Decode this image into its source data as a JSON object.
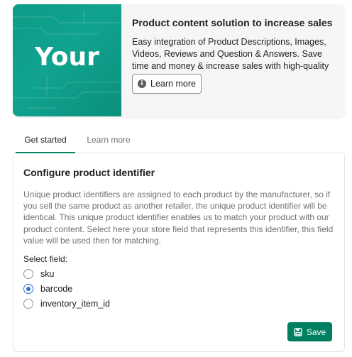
{
  "banner": {
    "logo_text": "Your",
    "title": "Product content solution to increase sales",
    "description": "Easy integration of Product Descriptions, Images, Videos, Reviews and Question & Answers. Save time and money & increase sales with high-quality content.",
    "learn_more_label": "Learn more",
    "info_icon": "info-icon",
    "brand_color": "#0c9b86"
  },
  "tabs": [
    {
      "label": "Get started",
      "active": true
    },
    {
      "label": "Learn more",
      "active": false
    }
  ],
  "configure": {
    "title": "Configure product identifier",
    "description": "Unique product identifiers are assigned to each product by the manufacturer, so if you sell the same product as another retailer, the unique product identifier will be identical. This unique product identifier enables us to match your product with our product content. Select here your store field that represents this identifier, this field value will be used then for matching.",
    "select_label": "Select field:",
    "options": [
      {
        "label": "sku",
        "checked": false
      },
      {
        "label": "barcode",
        "checked": true
      },
      {
        "label": "inventory_item_id",
        "checked": false
      }
    ],
    "save_label": "Save",
    "save_icon": "save-icon",
    "accent_color": "#008060",
    "radio_color": "#2c6ecb"
  }
}
